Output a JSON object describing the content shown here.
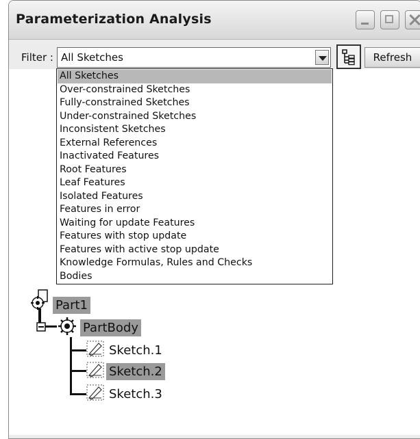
{
  "window": {
    "title": "Parameterization Analysis",
    "buttons": [
      "minimize-icon",
      "maximize-icon",
      "close-icon"
    ]
  },
  "filter": {
    "label": "Filter :",
    "selected": "All Sketches",
    "options": [
      "All Sketches",
      "Over-constrained Sketches",
      "Fully-constrained Sketches",
      "Under-constrained Sketches",
      "Inconsistent Sketches",
      "External References",
      "Inactivated Features",
      "Root Features",
      "Leaf Features",
      "Isolated Features",
      "Features in error",
      "Waiting for update Features",
      "Features with stop update",
      "Features with active stop update",
      "Knowledge Formulas, Rules and Checks",
      "Bodies"
    ]
  },
  "toolbar": {
    "tree_icon": "tree-view-icon",
    "refresh_label": "Refresh"
  },
  "tree": {
    "root": "Part1",
    "body": "PartBody",
    "sketches": [
      "Sketch.1",
      "Sketch.2",
      "Sketch.3"
    ],
    "highlighted": [
      "Part1",
      "PartBody",
      "Sketch.2"
    ]
  },
  "colors": {
    "highlight": "#9a9a9a",
    "selection": "#b8b8b8"
  }
}
